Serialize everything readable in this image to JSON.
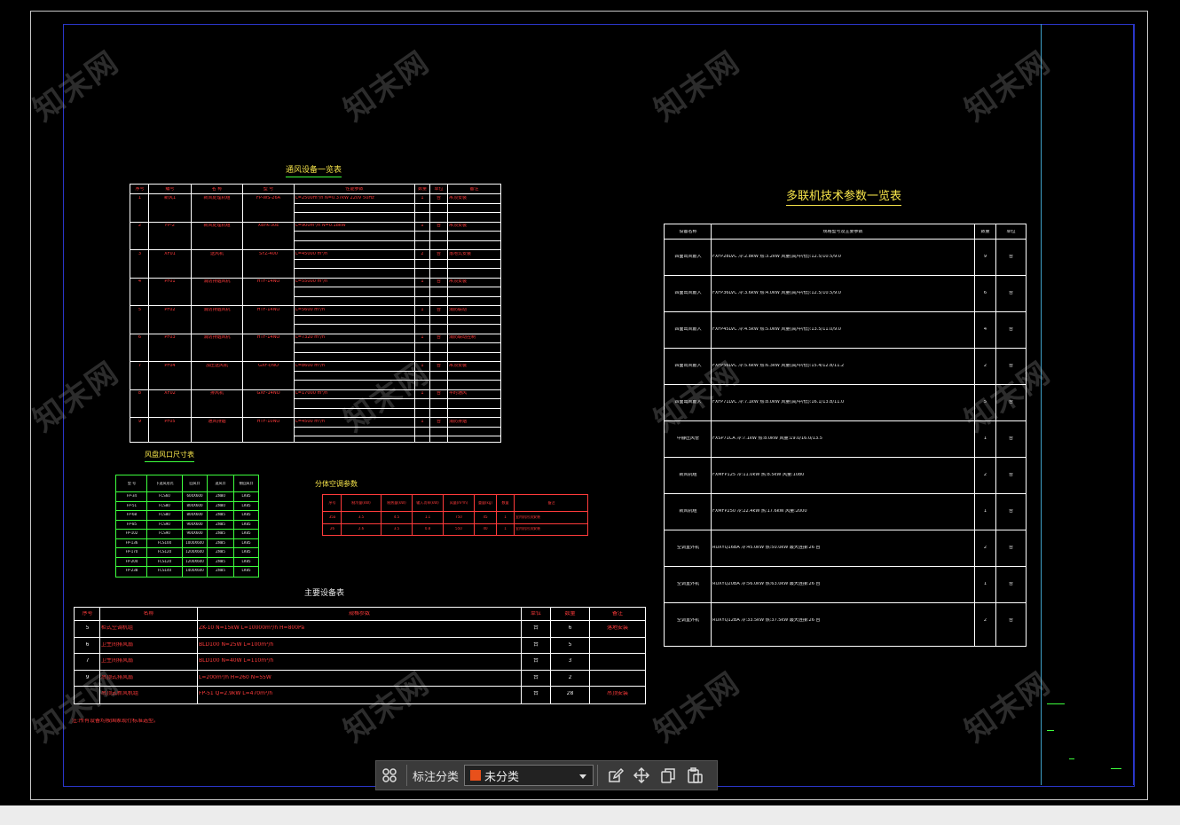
{
  "watermark": "知末网",
  "tables": {
    "ventilation": {
      "title": "通风设备一览表",
      "headers": [
        "序号",
        "编号",
        "名 称",
        "型 号",
        "性能参数",
        "数量",
        "单位",
        "备注"
      ],
      "rows": [
        [
          "1",
          "新风1",
          "新风处理机组",
          "FP-WS-26A",
          "L=2500m³/h N=0.37kW 220V 50Hz",
          "1",
          "台",
          "吊顶安装"
        ],
        [
          "2",
          "FP-2",
          "新风处理机组",
          "XBYK-30E",
          "L=900m³/h N=0.18kW",
          "1",
          "台",
          "吊顶安装"
        ],
        [
          "3",
          "XF01",
          "送风机",
          "SYZ-400",
          "L=45000 m³/h",
          "2",
          "台",
          "落地式安装"
        ],
        [
          "4",
          "PF01",
          "消防排烟风机",
          "HTF-14NO",
          "L=55000 m³/h",
          "1",
          "台",
          "吊顶安装"
        ],
        [
          "5",
          "PF02",
          "消防排烟风机",
          "HTF-14NO",
          "L=5600 m³/h",
          "1",
          "台",
          "消防联动"
        ],
        [
          "6",
          "PF03",
          "消防排烟风机",
          "HTF-14NO",
          "L=7320 m³/h",
          "1",
          "台",
          "消防联动控制"
        ],
        [
          "7",
          "PF04",
          "加压送风机",
          "GXF-I/NO",
          "L=8600 m³/h",
          "1",
          "台",
          "吊顶安装"
        ],
        [
          "8",
          "XF02",
          "排风机",
          "GXF-14NO",
          "L=17000 m³/h",
          "1",
          "台",
          "平时通风"
        ],
        [
          "9",
          "PF05",
          "通风排烟",
          "HTF-10NO",
          "L=4500 m³/h",
          "1",
          "台",
          "消防排烟"
        ]
      ]
    },
    "fan_size": {
      "title": "风盘风口尺寸表",
      "headers": [
        "型 号",
        "下送风形式",
        "回风口",
        "送风口",
        "侧回风口"
      ],
      "rows": [
        [
          "FP-34",
          "FCS60",
          "600X600",
          "ZN80",
          "LR85"
        ],
        [
          "FP-51",
          "FCS80",
          "800X600",
          "ZN80",
          "LR85"
        ],
        [
          "FP-68",
          "FCS80",
          "800X600",
          "ZN85",
          "LR85"
        ],
        [
          "FP-85",
          "FCS90",
          "900X600",
          "ZN85",
          "LR85"
        ],
        [
          "FP-102",
          "FCS90",
          "900X600",
          "ZN85",
          "LR85"
        ],
        [
          "FP-136",
          "FCS100",
          "1000X600",
          "ZN85",
          "LR85"
        ],
        [
          "FP-170",
          "FCS120",
          "1200X600",
          "ZN85",
          "LR85"
        ],
        [
          "FP-204",
          "FCS120",
          "1200X600",
          "ZN85",
          "LR85"
        ],
        [
          "FP-238",
          "FCS140",
          "1400X600",
          "ZN85",
          "LR85"
        ]
      ]
    },
    "multi_split_small": {
      "title": "分体空调参数",
      "headers": [
        "序号",
        "制冷量(kW)",
        "制热量(kW)",
        "输入功率(kW)",
        "风量(m³/h)",
        "重量(kg)",
        "数量",
        "备注"
      ],
      "rows": [
        [
          "35a",
          "3.5",
          "4.5",
          "1.1",
          "750",
          "45",
          "1",
          "室内机吊顶安装"
        ],
        [
          "26",
          "2.6",
          "3.5",
          "0.8",
          "550",
          "40",
          "1",
          "室内机吊顶安装"
        ]
      ]
    },
    "equipment": {
      "title": "主要设备表",
      "headers": [
        "序号",
        "名称",
        "规格参数",
        "单位",
        "数量",
        "备注"
      ],
      "rows": [
        [
          "5",
          "柜式空调机组",
          "ZK-10 N=15kW L=10000m³/h H=800Pa",
          "台",
          "6",
          "落地安装"
        ],
        [
          "6",
          "卫生间排风扇",
          "BLD100 N=25W L=100m³/h",
          "台",
          "5",
          ""
        ],
        [
          "7",
          "卫生间排风扇",
          "BLD100 N=40W L=110m³/h",
          "台",
          "3",
          ""
        ],
        [
          "9",
          "吊顶式排风扇",
          "L=200m³/h H=260 N=55W",
          "台",
          "2",
          ""
        ],
        [
          "",
          "吊顶式新风机组",
          "FP-51 Q=2.9kW L=470m³/h",
          "台",
          "28",
          "吊顶安装"
        ]
      ],
      "note": "注:所有设备均按国家现行标准选型。"
    },
    "multi_split": {
      "title": "多联机技术参数一览表",
      "headers": [
        "设备名称",
        "规格型号及主要参数",
        "数量",
        "单位"
      ],
      "rows": [
        [
          "四面出风嵌入",
          "FXFP28LVC 冷:2.8kW 热:3.2kW 风量(高/中/低):12.5/10.5/9.0",
          "9",
          "台"
        ],
        [
          "四面出风嵌入",
          "FXFP36LVC 冷:3.6kW 热:4.0kW 风量(高/中/低):12.5/10.5/9.0",
          "6",
          "台"
        ],
        [
          "四面出风嵌入",
          "FXFP45LVC 冷:4.5kW 热:5.0kW 风量(高/中/低):13.5/11.0/9.0",
          "4",
          "台"
        ],
        [
          "四面出风嵌入",
          "FXFP56LVC 冷:5.6kW 热:6.3kW 风量(高/中/低):15.4/12.8/11.2",
          "2",
          "台"
        ],
        [
          "四面出风嵌入",
          "FXFP71LVC 冷:7.1kW 热:8.0kW 风量(高/中/低):16.1/13.8/11.0",
          "5",
          "台"
        ],
        [
          "中静压风管",
          "FXSP71CA 冷:7.1kW 热:8.0kW 风量:19.0/16.0/13.5",
          "1",
          "台"
        ],
        [
          "新风机组",
          "FXMFP125 冷:11.0kW 热:8.5kW 风量:1080",
          "2",
          "台"
        ],
        [
          "新风机组",
          "FXMFP250 冷:22.4kW 热:17.6kW 风量:2000",
          "1",
          "台"
        ],
        [
          "空调室外机",
          "RUXYQ16BA 冷:45.0kW 热:50.0kW 最大连接:26 台",
          "2",
          "台"
        ],
        [
          "空调室外机",
          "RUXYQ20BA 冷:56.0kW 热:63.0kW 最大连接:26 台",
          "1",
          "台"
        ],
        [
          "空调室外机",
          "RUXYQ12BA 冷:33.5kW 热:37.5kW 最大连接:26 台",
          "2",
          "台"
        ]
      ]
    }
  },
  "toolbar": {
    "grid_icon": "grid-icon",
    "label": "标注分类",
    "select_value": "未分类",
    "swatch_color": "#e8501b",
    "icons": [
      "edit-icon",
      "move-icon",
      "copy-icon",
      "paste-icon"
    ]
  }
}
